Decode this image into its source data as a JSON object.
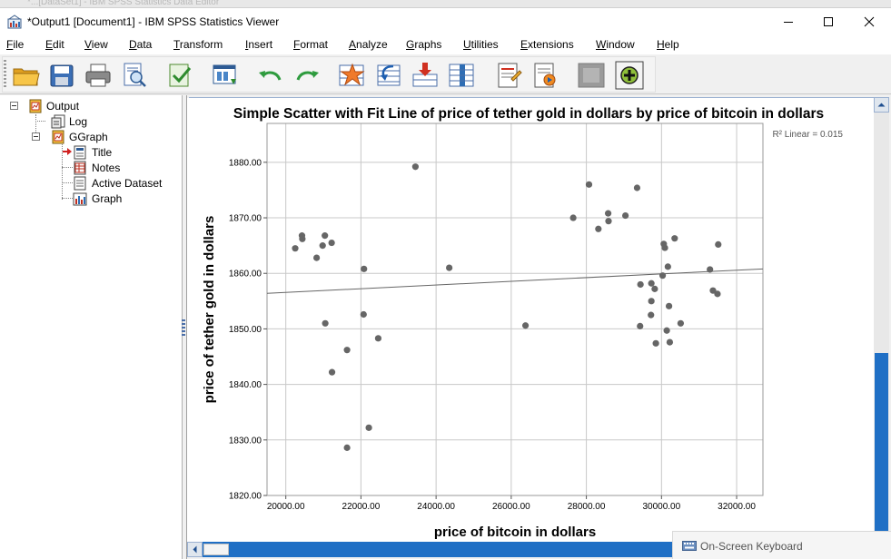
{
  "background_window": {
    "text": "*...[DataSet1] - IBM SPSS Statistics Data Editor"
  },
  "window": {
    "title": "*Output1 [Document1] - IBM SPSS Statistics Viewer",
    "controls": [
      "minimize",
      "maximize",
      "close"
    ]
  },
  "menu": {
    "file": "File",
    "edit": "Edit",
    "view": "View",
    "data": "Data",
    "transform": "Transform",
    "insert": "Insert",
    "format": "Format",
    "analyze": "Analyze",
    "graphs": "Graphs",
    "utilities": "Utilities",
    "extensions": "Extensions",
    "window": "Window",
    "help": "Help"
  },
  "toolbar": {
    "buttons": [
      "open-folder-icon",
      "save-icon",
      "print-icon",
      "print-preview-icon",
      "export-icon",
      "recall-dialog-icon",
      "undo-icon",
      "redo-icon",
      "goto-data-icon",
      "goto-case-icon",
      "goto-variable-icon",
      "variables-icon",
      "create-title-icon",
      "create-text-icon",
      "disabled-icon",
      "add-output-icon"
    ]
  },
  "outline": {
    "root": "Output",
    "log": "Log",
    "ggraph": "GGraph",
    "title": "Title",
    "notes": "Notes",
    "active_dataset": "Active Dataset",
    "graph": "Graph"
  },
  "chart_data": {
    "type": "scatter",
    "title": "Simple Scatter with Fit Line of price of tether gold in dollars by price of bitcoin in dollars",
    "xlabel": "price of bitcoin in dollars",
    "ylabel": "price of tether gold in dollars",
    "xlim": [
      19500,
      32700
    ],
    "ylim": [
      1820,
      1887
    ],
    "xticks": [
      "20000.00",
      "22000.00",
      "24000.00",
      "26000.00",
      "28000.00",
      "30000.00",
      "32000.00"
    ],
    "yticks": [
      "1820.00",
      "1830.00",
      "1840.00",
      "1850.00",
      "1860.00",
      "1870.00",
      "1880.00"
    ],
    "grid": true,
    "r2_label": "R² Linear = 0.015",
    "fit_line": {
      "x": [
        19500,
        32700
      ],
      "y": [
        1856.4,
        1860.8
      ]
    },
    "points": [
      {
        "x": 20250,
        "y": 1864.5
      },
      {
        "x": 20430,
        "y": 1866.8
      },
      {
        "x": 20440,
        "y": 1866.2
      },
      {
        "x": 20820,
        "y": 1862.8
      },
      {
        "x": 20980,
        "y": 1865.0
      },
      {
        "x": 21040,
        "y": 1866.8
      },
      {
        "x": 21050,
        "y": 1851.0
      },
      {
        "x": 21220,
        "y": 1865.5
      },
      {
        "x": 21230,
        "y": 1842.2
      },
      {
        "x": 21630,
        "y": 1846.2
      },
      {
        "x": 21630,
        "y": 1828.6
      },
      {
        "x": 22080,
        "y": 1860.8
      },
      {
        "x": 22070,
        "y": 1852.6
      },
      {
        "x": 22210,
        "y": 1832.2
      },
      {
        "x": 22460,
        "y": 1848.3
      },
      {
        "x": 23450,
        "y": 1879.2
      },
      {
        "x": 24350,
        "y": 1861.0
      },
      {
        "x": 26380,
        "y": 1850.6
      },
      {
        "x": 27650,
        "y": 1870.0
      },
      {
        "x": 28070,
        "y": 1876.0
      },
      {
        "x": 28320,
        "y": 1868.0
      },
      {
        "x": 28580,
        "y": 1870.8
      },
      {
        "x": 28590,
        "y": 1869.4
      },
      {
        "x": 29040,
        "y": 1870.4
      },
      {
        "x": 29350,
        "y": 1875.4
      },
      {
        "x": 29440,
        "y": 1858.0
      },
      {
        "x": 29430,
        "y": 1850.5
      },
      {
        "x": 29730,
        "y": 1858.2
      },
      {
        "x": 29730,
        "y": 1855.0
      },
      {
        "x": 29720,
        "y": 1852.5
      },
      {
        "x": 29820,
        "y": 1857.2
      },
      {
        "x": 29850,
        "y": 1847.4
      },
      {
        "x": 30060,
        "y": 1865.3
      },
      {
        "x": 30090,
        "y": 1864.6
      },
      {
        "x": 30030,
        "y": 1859.6
      },
      {
        "x": 30170,
        "y": 1861.2
      },
      {
        "x": 30140,
        "y": 1849.7
      },
      {
        "x": 30200,
        "y": 1854.1
      },
      {
        "x": 30220,
        "y": 1847.6
      },
      {
        "x": 30350,
        "y": 1866.3
      },
      {
        "x": 30510,
        "y": 1851.0
      },
      {
        "x": 31290,
        "y": 1860.7
      },
      {
        "x": 31370,
        "y": 1856.9
      },
      {
        "x": 31490,
        "y": 1856.3
      },
      {
        "x": 31510,
        "y": 1865.2
      }
    ]
  },
  "osk": {
    "label": "On-Screen Keyboard"
  },
  "colors": {
    "point": "#666666",
    "fit_line": "#666666",
    "grid": "#c8c8c8",
    "scroll_accent": "#1f6fc5"
  }
}
